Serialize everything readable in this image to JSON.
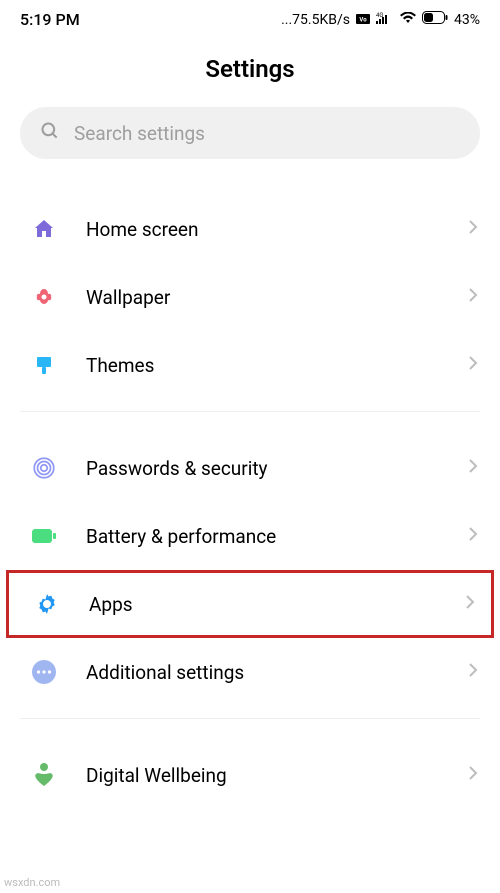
{
  "status": {
    "time": "5:19 PM",
    "speed": "...75.5KB/s",
    "volte": "▯",
    "signal": "4G",
    "bars": "▮▮▮▮",
    "wifi": "wifi",
    "battery_pct": "43%"
  },
  "page": {
    "title": "Settings"
  },
  "search": {
    "placeholder": "Search settings"
  },
  "items": [
    {
      "key": "home-screen",
      "label": "Home screen",
      "icon": "home",
      "color": "#7e6bd9"
    },
    {
      "key": "wallpaper",
      "label": "Wallpaper",
      "icon": "flower",
      "color": "#f06575"
    },
    {
      "key": "themes",
      "label": "Themes",
      "icon": "brush",
      "color": "#29b6f6"
    },
    {
      "key": "passwords",
      "label": "Passwords & security",
      "icon": "fingerprint",
      "color": "#9097f5"
    },
    {
      "key": "battery",
      "label": "Battery & performance",
      "icon": "battery",
      "color": "#4ade80"
    },
    {
      "key": "apps",
      "label": "Apps",
      "icon": "gear",
      "color": "#2196f3",
      "highlighted": true
    },
    {
      "key": "additional",
      "label": "Additional settings",
      "icon": "dots",
      "color": "#9fb6f0"
    },
    {
      "key": "wellbeing",
      "label": "Digital Wellbeing",
      "icon": "heart",
      "color": "#66bb6a"
    }
  ],
  "watermark": "wsxdn.com"
}
